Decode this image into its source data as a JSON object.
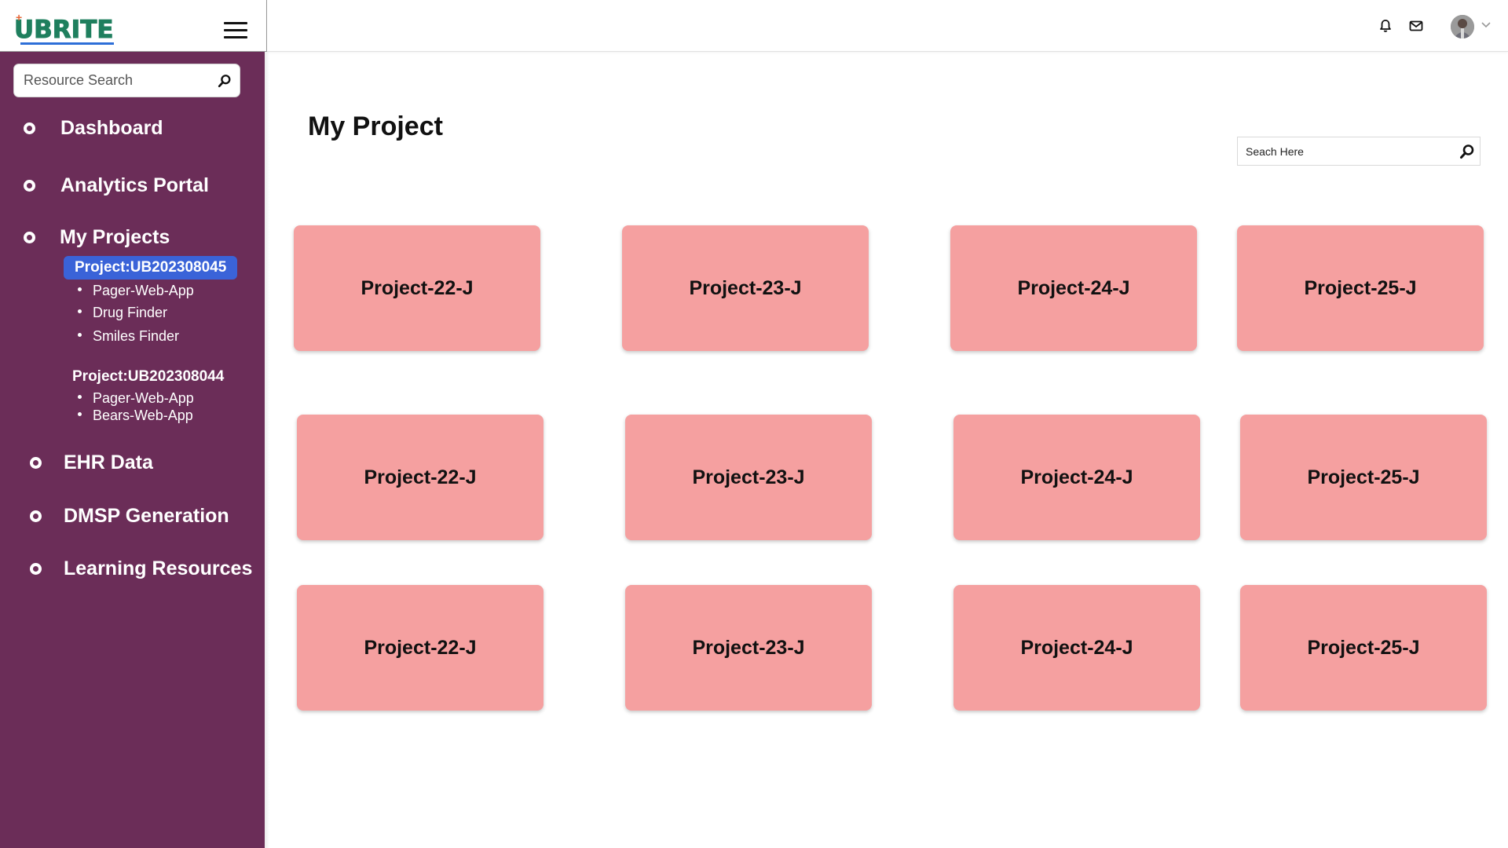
{
  "brand": {
    "logo_text": "UBRITE",
    "colors": {
      "logo_green": "#1f7f5e",
      "sidebar_bg": "#6b2d58",
      "active_project_bg": "#3a63d8",
      "card_bg": "#f5a0a0"
    }
  },
  "sidebar": {
    "search_placeholder": "Resource Search",
    "nav": {
      "dashboard": "Dashboard",
      "analytics": "Analytics Portal",
      "my_projects": "My Projects",
      "ehr_data": "EHR Data",
      "dmsp": "DMSP Generation",
      "learning": "Learning Resources"
    },
    "projects": [
      {
        "title": "Project:UB202308045",
        "apps": [
          "Pager-Web-App",
          "Drug Finder",
          "Smiles Finder"
        ]
      },
      {
        "title": "Project:UB202308044",
        "apps": [
          "Pager-Web-App",
          "Bears-Web-App"
        ]
      }
    ]
  },
  "header": {
    "icons": [
      "bell-icon",
      "mail-icon",
      "avatar",
      "chevron-down-icon"
    ]
  },
  "main": {
    "title": "My Project",
    "search_placeholder": "Seach Here",
    "cards": [
      [
        "Project-22-J",
        "Project-23-J",
        "Project-24-J",
        "Project-25-J"
      ],
      [
        "Project-22-J",
        "Project-23-J",
        "Project-24-J",
        "Project-25-J"
      ],
      [
        "Project-22-J",
        "Project-23-J",
        "Project-24-J",
        "Project-25-J"
      ]
    ]
  }
}
